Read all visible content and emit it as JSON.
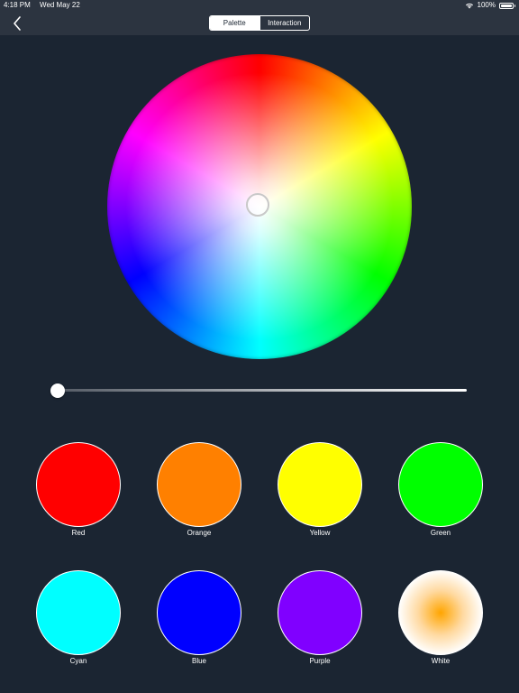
{
  "status_bar": {
    "time": "4:18 PM",
    "date": "Wed May 22",
    "battery": "100%"
  },
  "nav": {
    "tabs": [
      {
        "label": "Palette"
      },
      {
        "label": "Interaction"
      }
    ],
    "selected_tab": "Palette"
  },
  "brightness_slider": {
    "value": 0.0
  },
  "swatches": [
    {
      "label": "Red",
      "color": "#ff0000"
    },
    {
      "label": "Orange",
      "color": "#ff8000"
    },
    {
      "label": "Yellow",
      "color": "#ffff00"
    },
    {
      "label": "Green",
      "color": "#00ff00"
    },
    {
      "label": "Cyan",
      "color": "#00ffff"
    },
    {
      "label": "Blue",
      "color": "#0000ff"
    },
    {
      "label": "Purple",
      "color": "#8000ff"
    },
    {
      "label": "White",
      "color": "#ffa500"
    }
  ],
  "colors": {
    "background": "#1b2532",
    "bar": "#2c3440"
  }
}
